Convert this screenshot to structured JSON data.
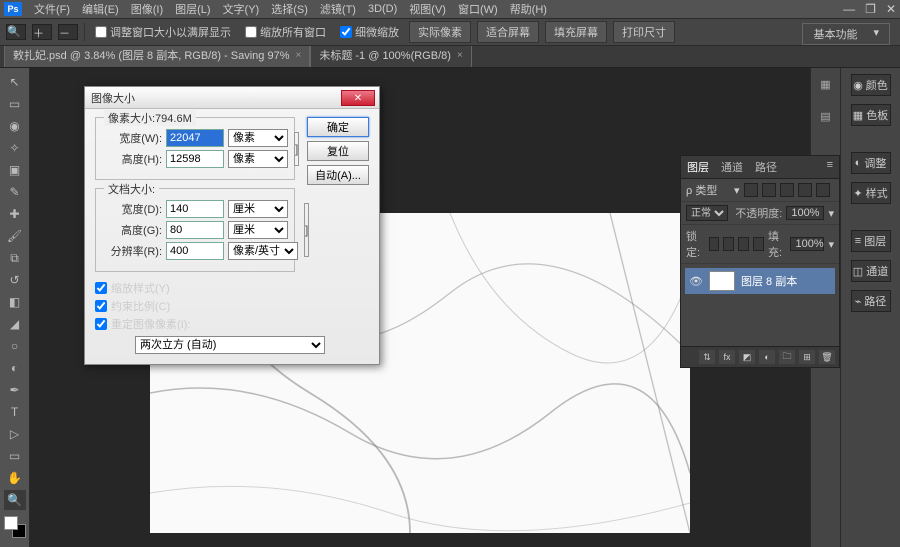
{
  "menu": {
    "items": [
      "文件(F)",
      "编辑(E)",
      "图像(I)",
      "图层(L)",
      "文字(Y)",
      "选择(S)",
      "滤镜(T)",
      "3D(D)",
      "视图(V)",
      "窗口(W)",
      "帮助(H)"
    ]
  },
  "win": {
    "min": "—",
    "max": "❐",
    "close": "✕"
  },
  "optbar": {
    "chk1": "调整窗口大小以满屏显示",
    "chk2": "缩放所有窗口",
    "chk3": "细微缩放",
    "btn1": "实际像素",
    "btn2": "适合屏幕",
    "btn3": "填充屏幕",
    "btn4": "打印尺寸",
    "workspace": "基本功能"
  },
  "tabs": {
    "t1": "敕扎妃.psd @ 3.84% (图层 8 副本, RGB/8) - Saving 97%",
    "t2": "未标题 -1 @ 100%(RGB/8)"
  },
  "dialog": {
    "title": "图像大小",
    "pixel_legend": "像素大小:794.6M",
    "w_lab": "宽度(W):",
    "w_val": "22047",
    "w_unit": "像素",
    "h_lab": "高度(H):",
    "h_val": "12598",
    "h_unit": "像素",
    "doc_legend": "文档大小:",
    "dw_lab": "宽度(D):",
    "dw_val": "140",
    "dw_unit": "厘米",
    "dh_lab": "高度(G):",
    "dh_val": "80",
    "dh_unit": "厘米",
    "res_lab": "分辨率(R):",
    "res_val": "400",
    "res_unit": "像素/英寸",
    "chk_scale": "缩放样式(Y)",
    "chk_constrain": "约束比例(C)",
    "chk_resample": "重定图像像素(I):",
    "interp": "两次立方 (自动)",
    "ok": "确定",
    "reset": "复位",
    "auto": "自动(A)..."
  },
  "layers": {
    "tab1": "图层",
    "tab2": "通道",
    "tab3": "路径",
    "kind": "ρ 类型",
    "blend": "正常",
    "opacity_lab": "不透明度:",
    "opacity": "100%",
    "lock_lab": "锁定:",
    "fill_lab": "填充:",
    "fill": "100%",
    "layer_name": "图层 8 副本"
  },
  "dock": {
    "i1": "颜色",
    "i2": "色板",
    "i3": "调整",
    "i4": "样式",
    "i5": "图层",
    "i6": "通道",
    "i7": "路径"
  }
}
